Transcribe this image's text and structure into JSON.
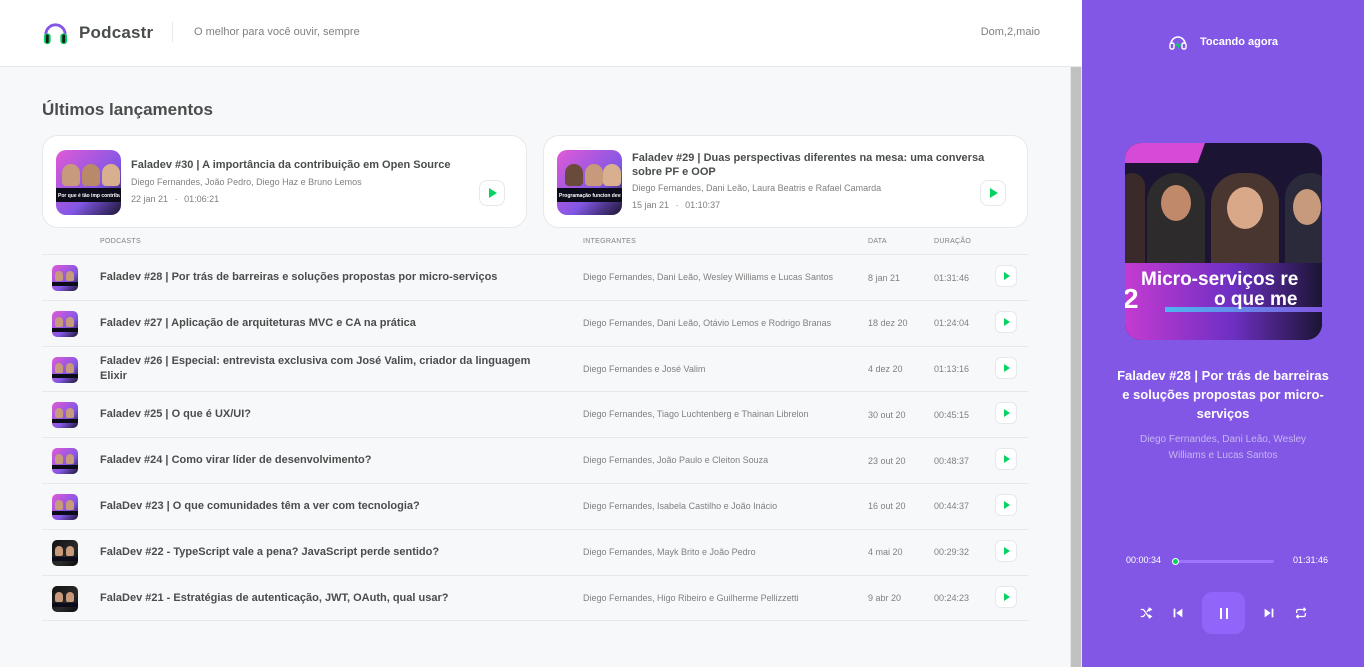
{
  "header": {
    "app_name": "Podcastr",
    "tagline": "O melhor para você ouvir, sempre",
    "date": "Dom,2,maio"
  },
  "latest": {
    "title": "Últimos lançamentos",
    "episodes": [
      {
        "title": "Faladev #30 | A importância da contribuição em Open Source",
        "members": "Diego Fernandes, João Pedro, Diego Haz e Bruno Lemos",
        "date": "22 jan 21",
        "separator": "·",
        "duration": "01:06:21",
        "thumb_caption": "Por que é tão imp contribuir em Open S"
      },
      {
        "title": "Faladev #29 | Duas perspectivas diferentes na mesa: uma conversa sobre PF e OOP",
        "members": "Diego Fernandes, Dani Leão, Laura Beatris e Rafael Camarda",
        "date": "15 jan 21",
        "separator": "·",
        "duration": "01:10:37",
        "thumb_caption": "Programação funcion devs orientados a"
      }
    ]
  },
  "table": {
    "headers": {
      "podcasts": "PODCASTS",
      "members": "INTEGRANTES",
      "date": "DATA",
      "duration": "DURAÇÃO"
    },
    "rows": [
      {
        "title": "Faladev #28 | Por trás de barreiras e soluções propostas por micro-serviços",
        "members": "Diego Fernandes, Dani Leão, Wesley Williams e Lucas Santos",
        "date": "8 jan 21",
        "duration": "01:31:46"
      },
      {
        "title": "Faladev #27 | Aplicação de arquiteturas MVC e CA na prática",
        "members": "Diego Fernandes, Dani Leão, Otávio Lemos e Rodrigo Branas",
        "date": "18 dez 20",
        "duration": "01:24:04"
      },
      {
        "title": "Faladev #26 | Especial: entrevista exclusiva com José Valim, criador da linguagem Elixir",
        "members": "Diego Fernandes e José Valim",
        "date": "4 dez 20",
        "duration": "01:13:16"
      },
      {
        "title": "Faladev #25 | O que é UX/UI?",
        "members": "Diego Fernandes, Tiago Luchtenberg e Thainan Librelon",
        "date": "30 out 20",
        "duration": "00:45:15"
      },
      {
        "title": "Faladev #24 | Como virar líder de desenvolvimento?",
        "members": "Diego Fernandes, João Paulo e Cleiton Souza",
        "date": "23 out 20",
        "duration": "00:48:37"
      },
      {
        "title": "FalaDev #23 | O que comunidades têm a ver com tecnologia?",
        "members": "Diego Fernandes, Isabela Castilho e João Inácio",
        "date": "16 out 20",
        "duration": "00:44:37"
      },
      {
        "title": "FalaDev #22 - TypeScript vale a pena? JavaScript perde sentido?",
        "members": "Diego Fernandes, Mayk Brito e João Pedro",
        "date": "4 mai 20",
        "duration": "00:29:32"
      },
      {
        "title": "FalaDev #21 - Estratégias de autenticação, JWT, OAuth, qual usar?",
        "members": "Diego Fernandes, Higo Ribeiro e Guilherme Pellizzetti",
        "date": "9 abr 20",
        "duration": "00:24:23"
      }
    ]
  },
  "player": {
    "header": "Tocando agora",
    "cover_text_line1": "Micro-serviços re",
    "cover_text_line2": "o que me",
    "cover_number": "2",
    "title": "Faladev #28 | Por trás de barreiras e soluções propostas por micro-serviços",
    "members": "Diego Fernandes, Dani Leão, Wesley Williams e Lucas Santos",
    "current_time": "00:00:34",
    "total_time": "01:31:46",
    "progress_fraction": 0.006,
    "controls": [
      "shuffle-icon",
      "previous-icon",
      "pause-icon",
      "next-icon",
      "repeat-icon"
    ]
  },
  "colors": {
    "brand_purple": "#8257e5",
    "accent_green": "#04d361",
    "text": "#494d4b",
    "muted": "#808080"
  }
}
